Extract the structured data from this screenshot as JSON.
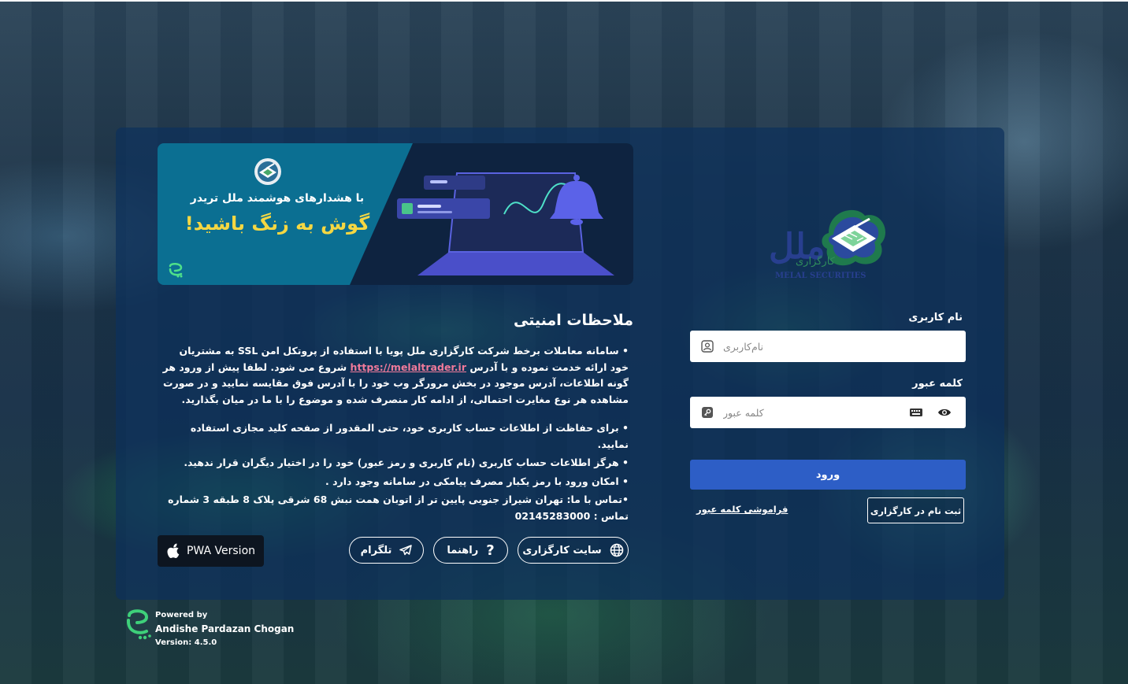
{
  "banner": {
    "line1": "با هشدارهای هوشمند ملل تریدر",
    "line2": "گوش به زنگ باشید!"
  },
  "security": {
    "title": "ملاحظات امنیتی",
    "note1_before": "• سامانه معاملات برخط شرکت کارگزاری ملل پویا با استفاده از پروتکل امن SSL به مشتریان خود ارائه خدمت نموده و با آدرس ",
    "note1_link": "https://melaltrader.ir",
    "note1_after": " شروع می شود. لطفا پیش از ورود هر گونه اطلاعات، آدرس موجود در بخش مرورگر وب خود را با آدرس فوق مقایسه نمایید و در صورت مشاهده هر نوع مغایرت احتمالی، از ادامه کار منصرف شده و موضوع را با ما در میان بگذارید.",
    "note2": "• برای حفاظت از اطلاعات حساب کاربری خود، حتی المقدور از صفحه کلید مجازی استفاده نمایید.",
    "note3": "• هرگز اطلاعات حساب کاربری (نام کاربری و رمز عبور) خود را در اختیار دیگران قرار ندهید.",
    "note4": "• امکان ورود با رمز یکبار مصرف پیامکی در سامانه وجود دارد .",
    "note5": "•تماس با ما: تهران شیراز جنوبی پایین تر از اتوبان همت نبش 68 شرقی پلاک 8 طبقه 3 شماره تماس : 02145283000"
  },
  "links": {
    "broker_site": "سایت کارگزاری",
    "guide": "راهنما",
    "telegram": "تلگرام",
    "pwa": "PWA Version"
  },
  "login": {
    "username_label": "نام کاربری",
    "username_placeholder": "نام‌کاربری",
    "password_label": "کلمه عبور",
    "password_placeholder": "کلمه عبور",
    "submit": "ورود",
    "register": "ثبت نام در کارگزاری",
    "forgot": "فراموشی کلمه عبور"
  },
  "logo": {
    "text_fa": "ملل",
    "text_sub": "کارگزاری",
    "text_en": "MELAL SECURITIES"
  },
  "footer": {
    "powered_by": "Powered by",
    "company": "Andishe Pardazan Chogan",
    "version": "Version: 4.5.0"
  },
  "colors": {
    "primary_button": "#2d5ec6",
    "banner_yellow": "#f5d742",
    "link_pink": "#f07a9a"
  }
}
